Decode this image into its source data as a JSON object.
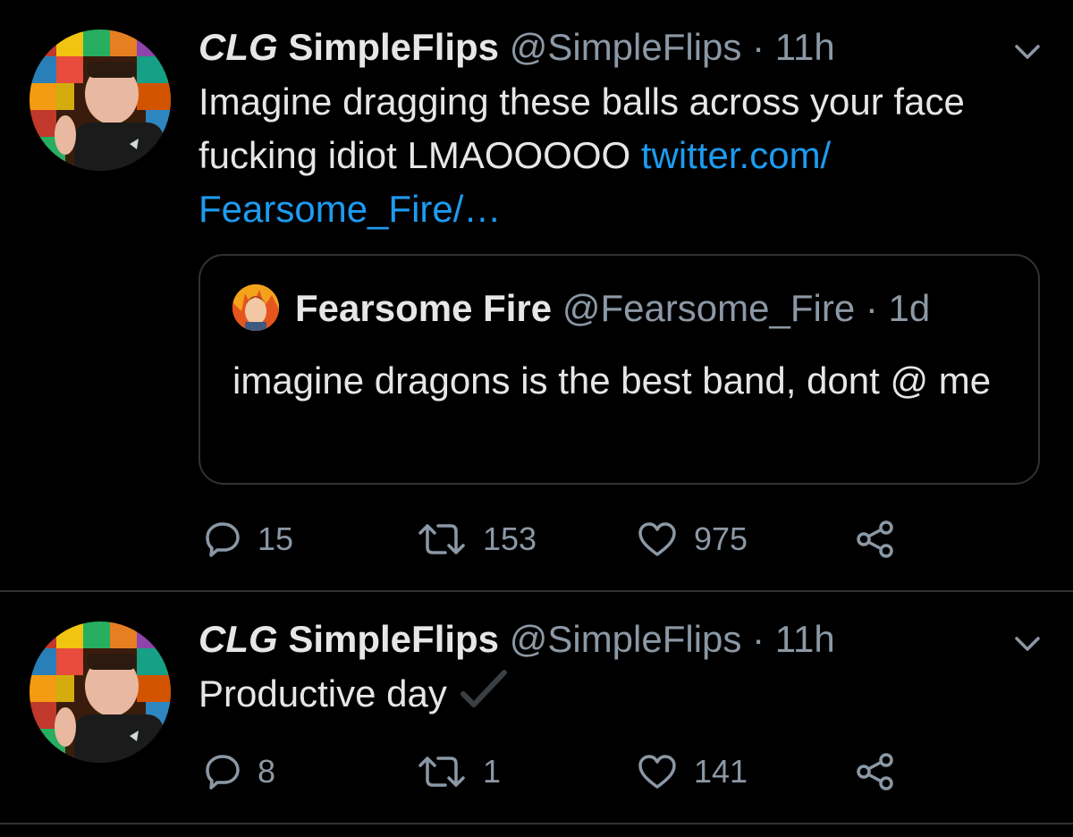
{
  "colors": {
    "background": "#000000",
    "text": "#e6e6e6",
    "muted": "#8b98a5",
    "link": "#1d9bf0",
    "border": "#2f3336"
  },
  "tweets": [
    {
      "name_prefix": "CLG",
      "name": "SimpleFlips",
      "handle_time": "@SimpleFlips · 11h",
      "text": "Imagine dragging these balls across your face fucking idiot LMAOOOOO ",
      "link_text": "twitter.com/ Fearsome_Fire/…",
      "quote": {
        "name": "Fearsome Fire",
        "handle_time": "@Fearsome_Fire · 1d",
        "text": "imagine dragons is the best band, dont @ me"
      },
      "actions": {
        "replies": "15",
        "retweets": "153",
        "likes": "975"
      }
    },
    {
      "name_prefix": "CLG",
      "name": "SimpleFlips",
      "handle_time": "@SimpleFlips · 11h",
      "text": "Productive day",
      "actions": {
        "replies": "8",
        "retweets": "1",
        "likes": "141"
      }
    }
  ]
}
